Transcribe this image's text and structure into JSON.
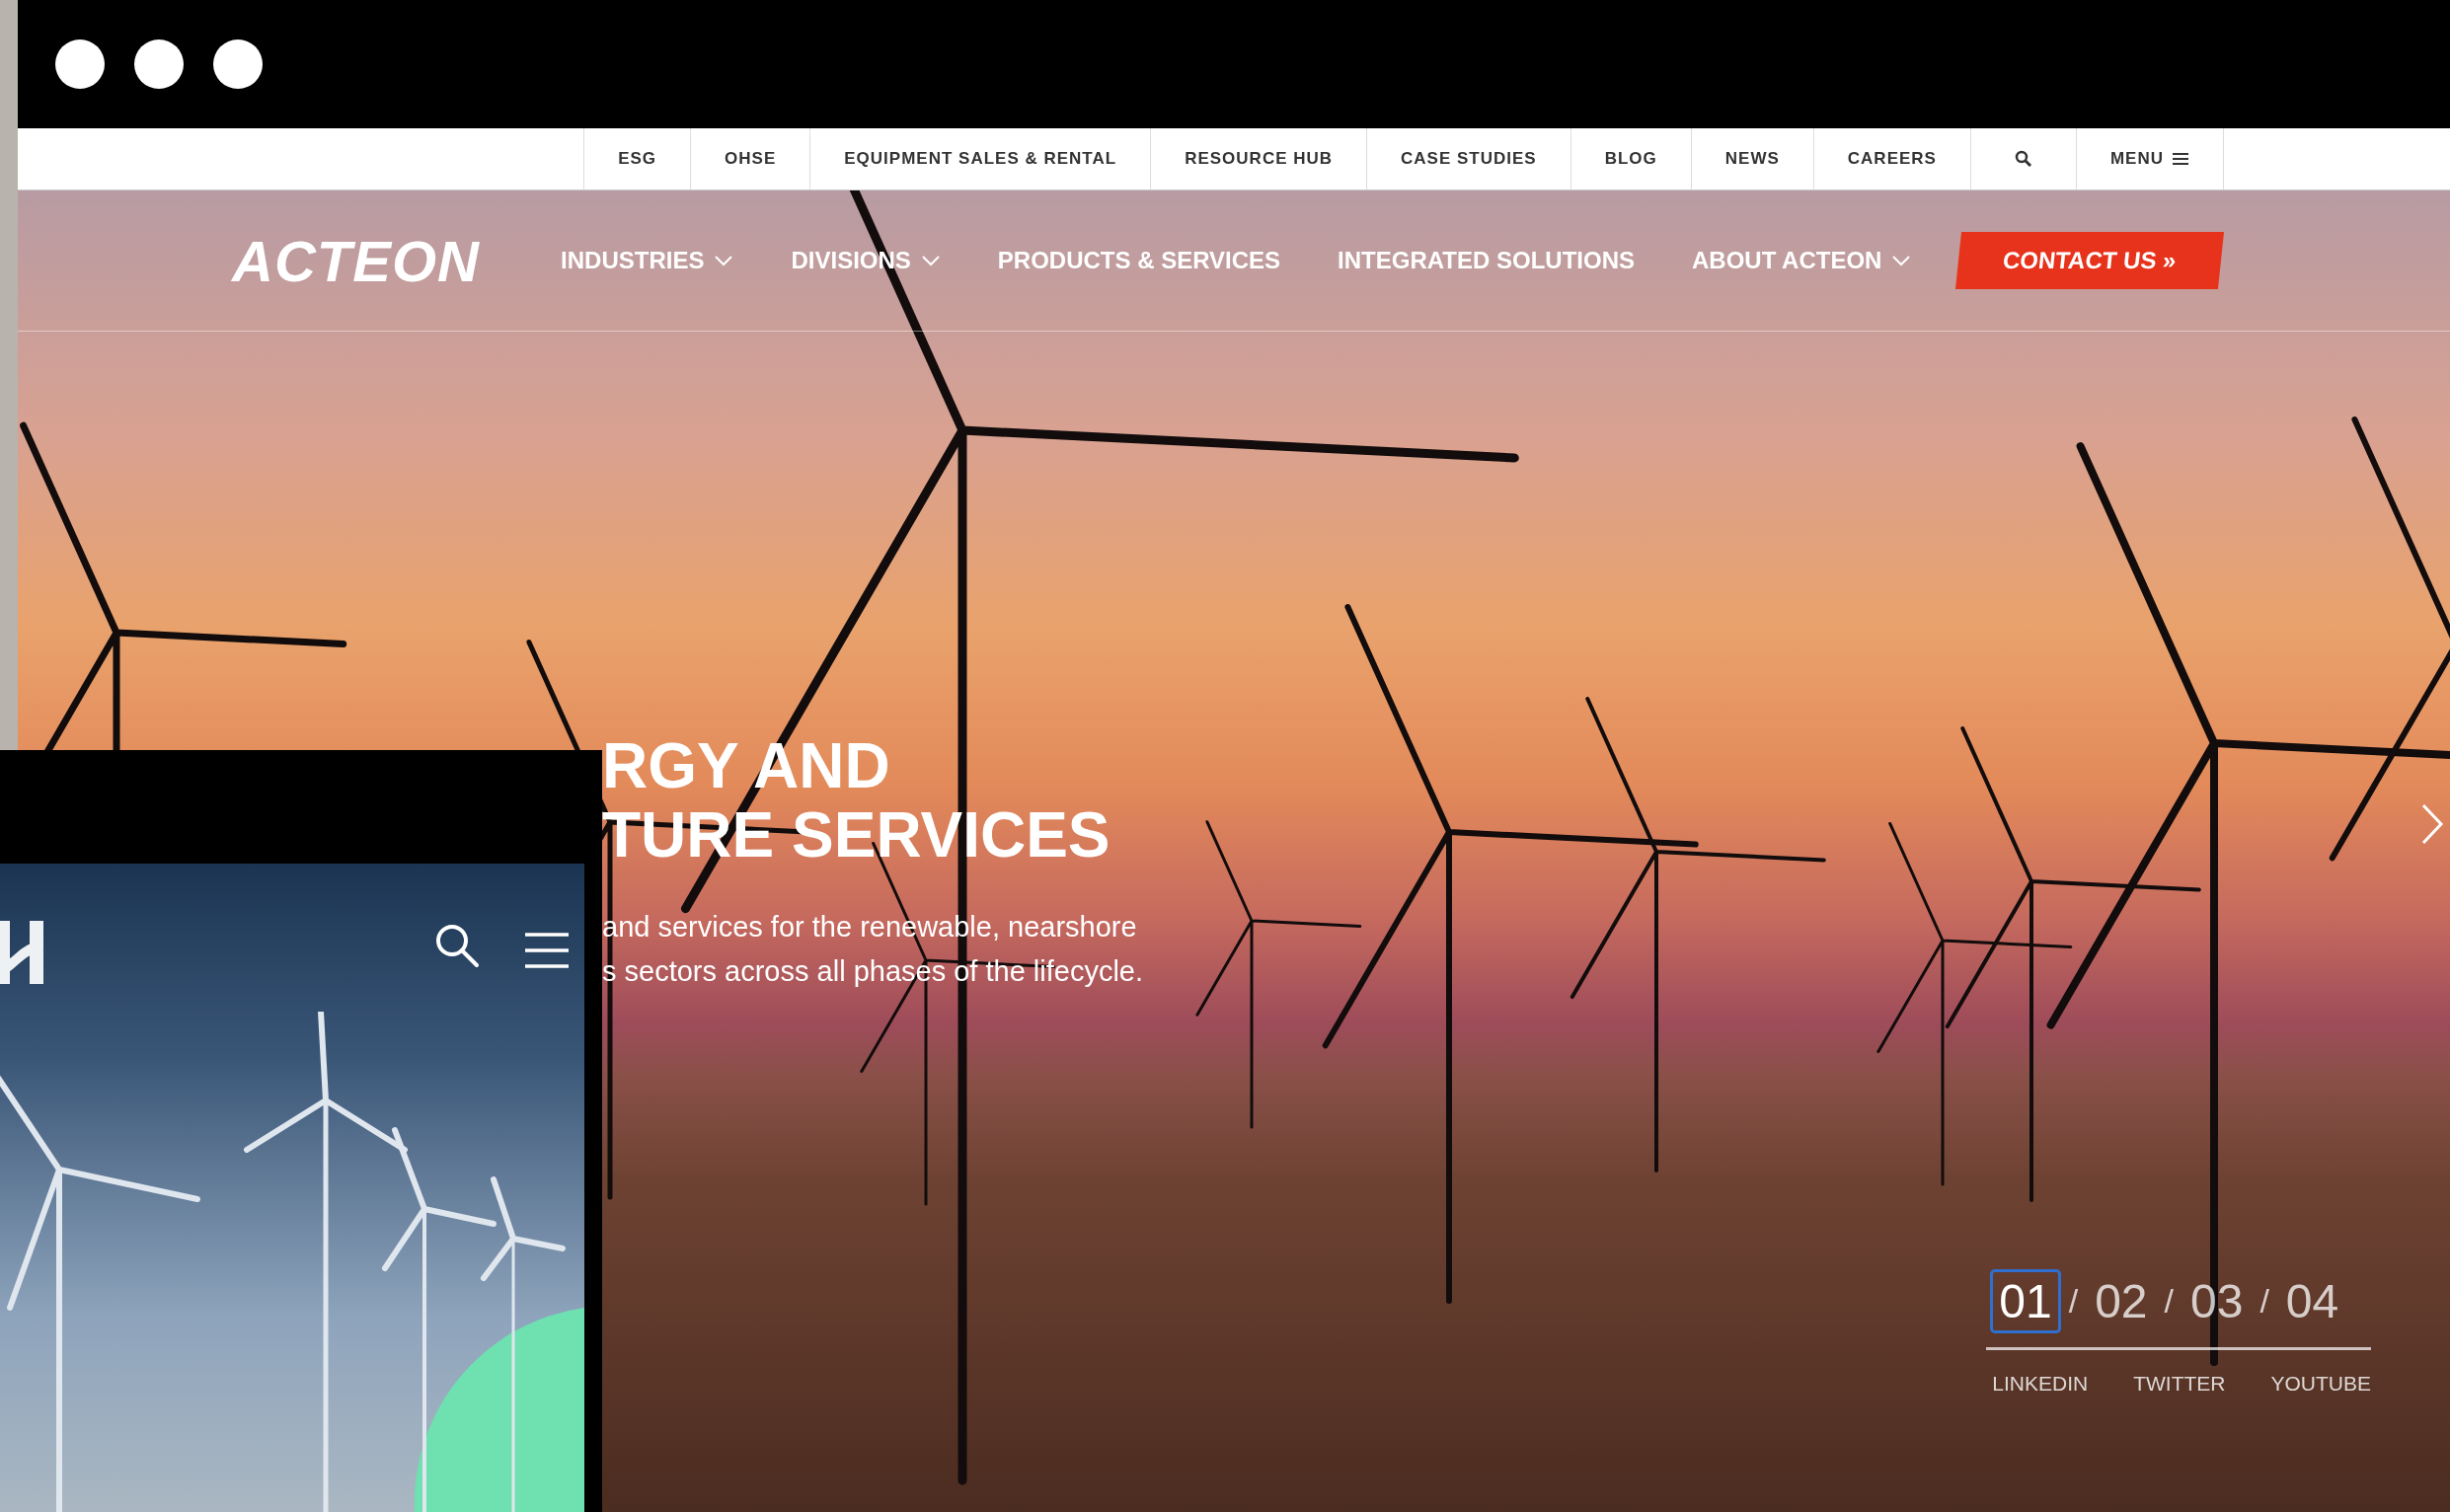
{
  "top_links": [
    {
      "label": "ESG"
    },
    {
      "label": "OHSE"
    },
    {
      "label": "EQUIPMENT SALES & RENTAL"
    },
    {
      "label": "RESOURCE HUB"
    },
    {
      "label": "CASE STUDIES"
    },
    {
      "label": "BLOG"
    },
    {
      "label": "NEWS"
    },
    {
      "label": "CAREERS"
    }
  ],
  "top_menu": {
    "label": "MENU"
  },
  "logo": "ACTEON",
  "nav": [
    {
      "label": "INDUSTRIES",
      "dropdown": true
    },
    {
      "label": "DIVISIONS",
      "dropdown": true
    },
    {
      "label": "PRODUCTS & SERVICES",
      "dropdown": false
    },
    {
      "label": "INTEGRATED SOLUTIONS",
      "dropdown": false
    },
    {
      "label": "ABOUT ACTEON",
      "dropdown": true
    }
  ],
  "contact_button": "CONTACT US »",
  "hero": {
    "title_lines": [
      "RGY AND",
      "TURE SERVICES"
    ],
    "subtitle_lines": [
      "and services for the renewable, nearshore",
      "s sectors across all phases of the lifecycle."
    ]
  },
  "slides": [
    {
      "label": "01",
      "selected": true
    },
    {
      "label": "02",
      "selected": false
    },
    {
      "label": "03",
      "selected": false
    },
    {
      "label": "04",
      "selected": false
    }
  ],
  "slide_separator": "/",
  "social_links": [
    "LINKEDIN",
    "TWITTER",
    "YOUTUBE"
  ]
}
